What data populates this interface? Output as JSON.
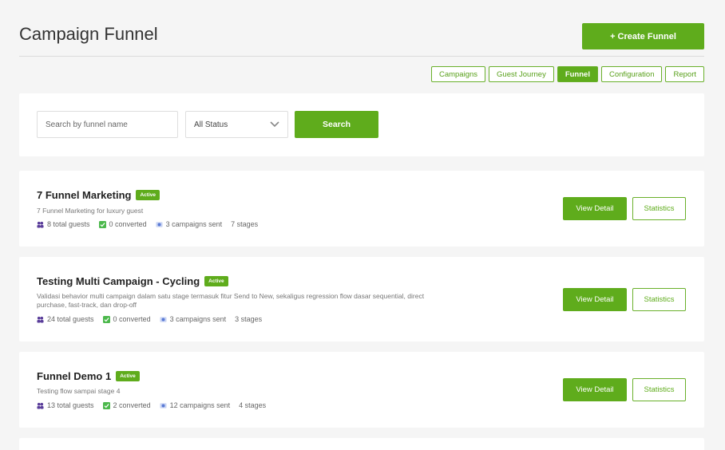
{
  "header": {
    "title": "Campaign Funnel",
    "create_label": "+ Create Funnel"
  },
  "tabs": [
    {
      "label": "Campaigns",
      "active": false
    },
    {
      "label": "Guest Journey",
      "active": false
    },
    {
      "label": "Funnel",
      "active": true
    },
    {
      "label": "Configuration",
      "active": false
    },
    {
      "label": "Report",
      "active": false
    }
  ],
  "search": {
    "placeholder": "Search by funnel name",
    "value": "",
    "status_selected": "All Status",
    "button_label": "Search"
  },
  "funnels": [
    {
      "name": "7 Funnel Marketing",
      "status": "Active",
      "description": "7 Funnel Marketing for luxury guest",
      "total_guests": "8 total guests",
      "converted": "0 converted",
      "campaigns_sent": "3 campaigns sent",
      "stages": "7 stages"
    },
    {
      "name": "Testing Multi Campaign - Cycling",
      "status": "Active",
      "description": "Validasi behavior multi campaign dalam satu stage termasuk fitur Send to New, sekaligus regression flow dasar sequential, direct purchase, fast-track, dan drop-off",
      "total_guests": "24 total guests",
      "converted": "0 converted",
      "campaigns_sent": "3 campaigns sent",
      "stages": "3 stages"
    },
    {
      "name": "Funnel Demo 1",
      "status": "Active",
      "description": "Testing flow sampai stage 4",
      "total_guests": "13 total guests",
      "converted": "2 converted",
      "campaigns_sent": "12 campaigns sent",
      "stages": "4 stages"
    }
  ],
  "actions": {
    "view_detail": "View Detail",
    "statistics": "Statistics"
  },
  "colors": {
    "accent": "#5fac1c",
    "background": "#f5f5f5",
    "guests_icon": "#5a3d9a",
    "converted_icon": "#4cb84c",
    "campaign_icon": "#5b7bd5"
  }
}
